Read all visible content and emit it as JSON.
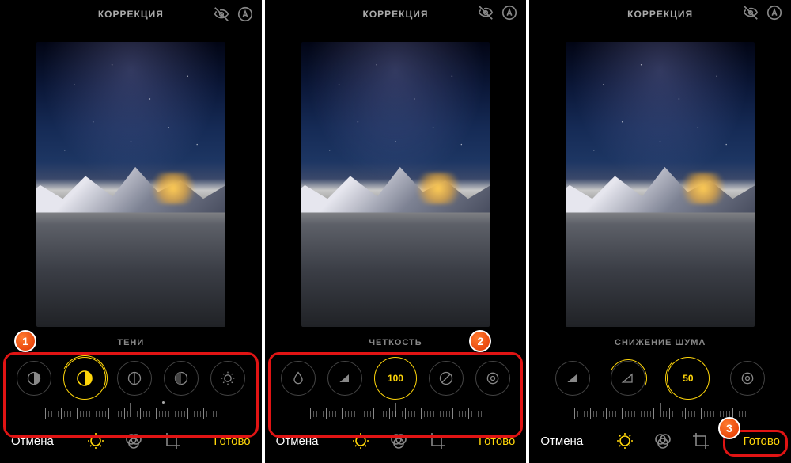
{
  "panels": [
    {
      "top_title": "КОРРЕКЦИЯ",
      "param": "ТЕНИ",
      "dials": [
        "contrast-alt-icon",
        "contrast-icon",
        "split-circle-icon",
        "halfdark-icon",
        "brightness-icon"
      ],
      "active_index": 1,
      "active_value": "",
      "cancel": "Отмена",
      "done": "Готово",
      "callout_num": "1",
      "callout_pos": "left",
      "ruler_dot_left": "62%"
    },
    {
      "top_title": "КОРРЕКЦИЯ",
      "param": "ЧЕТКОСТЬ",
      "dials": [
        "drop-icon",
        "triangle-icon",
        "value",
        "halfdark-alt-icon",
        "ring-icon"
      ],
      "active_index": 2,
      "active_value": "100",
      "cancel": "Отмена",
      "done": "Готово",
      "callout_num": "2",
      "callout_pos": "right",
      "ruler_dot_left": ""
    },
    {
      "top_title": "КОРРЕКЦИЯ",
      "param": "СНИЖЕНИЕ ШУМА",
      "dials": [
        "triangle-icon",
        "triangle-outline-icon",
        "value",
        "ring-icon"
      ],
      "active_index": 2,
      "active_value": "50",
      "cancel": "Отмена",
      "done": "Готово",
      "callout_num": "3",
      "callout_pos": "done",
      "ruler_dot_left": ""
    }
  ]
}
